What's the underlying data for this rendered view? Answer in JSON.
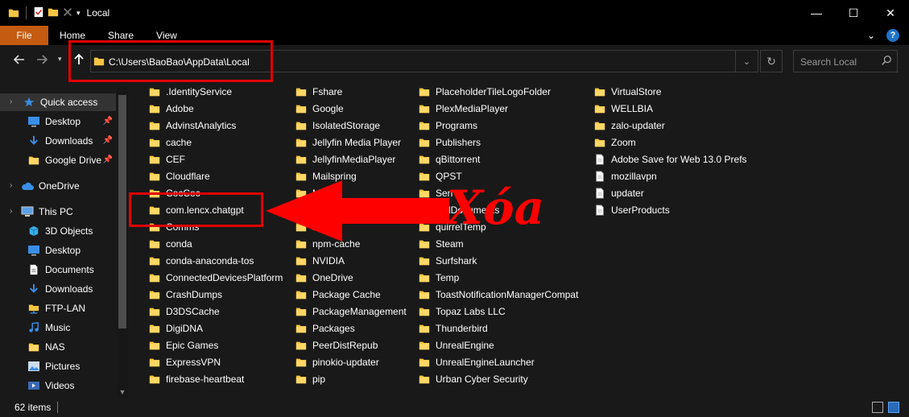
{
  "window": {
    "title": "Local",
    "minimize_glyph": "—",
    "maximize_glyph": "☐",
    "close_glyph": "✕"
  },
  "ribbon": {
    "tabs": [
      "File",
      "Home",
      "Share",
      "View"
    ],
    "collapse_glyph": "⌄",
    "help_glyph": "?"
  },
  "address_bar": {
    "path": "C:\\Users\\BaoBao\\AppData\\Local"
  },
  "search": {
    "placeholder": "Search Local"
  },
  "nav_pane": {
    "items": [
      {
        "label": "Quick access",
        "icon": "star-icon",
        "pinned": false,
        "selected": true
      },
      {
        "label": "Desktop",
        "icon": "desktop-icon",
        "pinned": true
      },
      {
        "label": "Downloads",
        "icon": "download-icon",
        "pinned": true
      },
      {
        "label": "Google Drive",
        "icon": "folder-icon",
        "pinned": true
      },
      {
        "label": "OneDrive",
        "icon": "cloud-icon",
        "pinned": false
      },
      {
        "label": "This PC",
        "icon": "computer-icon",
        "pinned": false
      },
      {
        "label": "3D Objects",
        "icon": "cube-icon",
        "pinned": false
      },
      {
        "label": "Desktop",
        "icon": "desktop-icon",
        "pinned": false
      },
      {
        "label": "Documents",
        "icon": "document-icon",
        "pinned": false
      },
      {
        "label": "Downloads",
        "icon": "download-icon",
        "pinned": false
      },
      {
        "label": "FTP-LAN",
        "icon": "network-folder-icon",
        "pinned": false
      },
      {
        "label": "Music",
        "icon": "music-icon",
        "pinned": false
      },
      {
        "label": "NAS",
        "icon": "folder-icon",
        "pinned": false
      },
      {
        "label": "Pictures",
        "icon": "pictures-icon",
        "pinned": false
      },
      {
        "label": "Videos",
        "icon": "video-icon",
        "pinned": false
      }
    ]
  },
  "files": {
    "columns": [
      [
        ".IdentityService",
        "Adobe",
        "AdvinstAnalytics",
        "cache",
        "CEF",
        "Cloudflare",
        "CocCoc",
        "com.lencx.chatgpt",
        "Comms",
        "conda",
        "conda-anaconda-tos",
        "ConnectedDevicesPlatform",
        "CrashDumps",
        "D3DSCache",
        "DigiDNA",
        "Epic Games",
        "ExpressVPN",
        "firebase-heartbeat"
      ],
      [
        "Fshare",
        "Google",
        "IsolatedStorage",
        "Jellyfin Media Player",
        "JellyfinMediaPlayer",
        "Mailspring",
        "Mic",
        "",
        "mp",
        "npm-cache",
        "NVIDIA",
        "OneDrive",
        "Package Cache",
        "PackageManagement",
        "Packages",
        "PeerDistRepub",
        "pinokio-updater",
        "pip"
      ],
      [
        "PlaceholderTileLogoFolder",
        "PlexMediaPlayer",
        "Programs",
        "Publishers",
        "qBittorrent",
        "QPST",
        "Sen",
        "olidDocuments",
        "quirrelTemp",
        "Steam",
        "Surfshark",
        "Temp",
        "ToastNotificationManagerCompat",
        "Topaz Labs LLC",
        "Thunderbird",
        "UnrealEngine",
        "UnrealEngineLauncher",
        "Urban Cyber Security"
      ],
      [
        "VirtualStore",
        "WELLBIA",
        "zalo-updater",
        "Zoom",
        "Adobe Save for Web 13.0 Prefs",
        "mozillavpn",
        "updater",
        "UserProducts"
      ]
    ],
    "column4_types": [
      "folder",
      "folder",
      "folder",
      "folder",
      "file",
      "file",
      "file",
      "file"
    ]
  },
  "status_bar": {
    "item_count": "62 items"
  },
  "annotation": {
    "text": "Xóa",
    "color": "#ff0000"
  },
  "colors": {
    "folder": "#f5c542",
    "file_tab": "#c55a11",
    "annotation": "#e00000"
  }
}
